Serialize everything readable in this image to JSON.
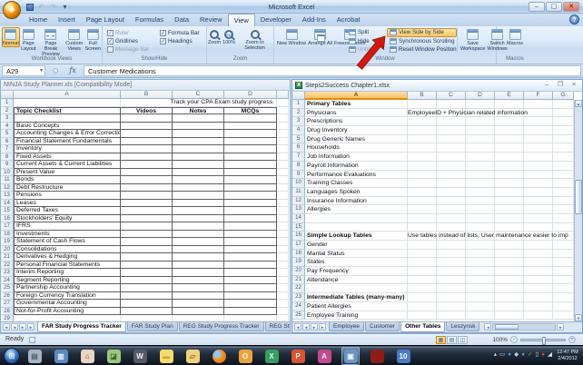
{
  "titlebar": {
    "title": "Microsoft Excel"
  },
  "ribbon": {
    "active_tab": "View",
    "tabs": [
      "Home",
      "Insert",
      "Page Layout",
      "Formulas",
      "Data",
      "Review",
      "View",
      "Developer",
      "Add-Ins",
      "Acrobat"
    ],
    "groups": {
      "workbook_views": {
        "label": "Workbook Views",
        "buttons": [
          {
            "label": "Normal",
            "icon": "normal-view-icon",
            "selected": true
          },
          {
            "label": "Page Layout",
            "icon": "page-layout-icon"
          },
          {
            "label": "Page Break Preview",
            "icon": "page-break-preview-icon"
          },
          {
            "label": "Custom Views",
            "icon": "custom-views-icon"
          },
          {
            "label": "Full Screen",
            "icon": "full-screen-icon"
          }
        ]
      },
      "show_hide": {
        "label": "Show/Hide",
        "col1": [
          {
            "label": "Ruler",
            "checked": true,
            "disabled": true
          },
          {
            "label": "Gridlines",
            "checked": true
          },
          {
            "label": "Message Bar",
            "checked": false,
            "disabled": true
          }
        ],
        "col2": [
          {
            "label": "Formula Bar",
            "checked": true
          },
          {
            "label": "Headings",
            "checked": true
          }
        ]
      },
      "zoom": {
        "label": "Zoom",
        "buttons": [
          {
            "label": "Zoom",
            "icon": "zoom-icon"
          },
          {
            "label": "100%",
            "icon": "zoom-100-icon"
          },
          {
            "label": "Zoom to Selection",
            "icon": "zoom-to-selection-icon"
          }
        ]
      },
      "window": {
        "label": "Window",
        "big_buttons": [
          {
            "label": "New Window",
            "icon": "new-window-icon"
          },
          {
            "label": "Arrange All",
            "icon": "arrange-all-icon"
          },
          {
            "label": "Freeze Panes",
            "icon": "freeze-panes-icon"
          }
        ],
        "small_buttons": [
          {
            "label": "Split",
            "icon": "split-icon"
          },
          {
            "label": "Hide",
            "icon": "hide-icon"
          },
          {
            "label": "Unhide",
            "icon": "unhide-icon",
            "disabled": true
          }
        ],
        "side_buttons": [
          {
            "label": "View Side by Side",
            "icon": "view-side-by-side-icon",
            "highlighted": true
          },
          {
            "label": "Synchronous Scrolling",
            "icon": "synchronous-scrolling-icon"
          },
          {
            "label": "Reset Window Position",
            "icon": "reset-window-position-icon"
          }
        ],
        "right_buttons": [
          {
            "label": "Save Workspace",
            "icon": "save-workspace-icon"
          },
          {
            "label": "Switch Windows",
            "icon": "switch-windows-icon"
          }
        ]
      },
      "macros": {
        "label": "Macros",
        "button": {
          "label": "Macros",
          "icon": "macros-icon"
        }
      }
    }
  },
  "formula_bar": {
    "name_box": "A29",
    "fx": "fx",
    "value": "Customer Medications"
  },
  "left_pane": {
    "caption": "NINJA Study Planner.xls  [Compatibility Mode]",
    "columns": [
      "A",
      "B",
      "C",
      "D"
    ],
    "rows": [
      {
        "overlay": "Track your CPA Exam study progress."
      },
      {
        "a": "Topic Checklist",
        "b": "Videos",
        "c": "Notes",
        "d": "MCQs",
        "bold": true
      },
      {},
      {
        "a": "Basic Concepts"
      },
      {
        "a": "Accounting Changes & Error Correction"
      },
      {
        "a": "Financial Statement Fundamentals"
      },
      {
        "a": "Inventory"
      },
      {
        "a": "Fixed Assets"
      },
      {
        "a": "Current Assets & Current Liabilities"
      },
      {
        "a": "Present Value"
      },
      {
        "a": "Bonds"
      },
      {
        "a": "Debt Restructure"
      },
      {
        "a": "Pensions"
      },
      {
        "a": "Leases"
      },
      {
        "a": "Deferred Taxes"
      },
      {
        "a": "Stockholders' Equity"
      },
      {
        "a": "IFRS"
      },
      {
        "a": "Investments"
      },
      {
        "a": "Statement of Cash Flows"
      },
      {
        "a": "Consolidations"
      },
      {
        "a": "Derivatives & Hedging"
      },
      {
        "a": "Personal Financial Statements"
      },
      {
        "a": "Interim Reporting"
      },
      {
        "a": "Segment Reporting"
      },
      {
        "a": "Partnership Accounting"
      },
      {
        "a": "Foreign Currency Translation"
      },
      {
        "a": "Governmental Accounting"
      },
      {
        "a": "Not-for-Profit Accounting"
      },
      {}
    ],
    "sheet_tabs": [
      {
        "label": "FAR Study Progress Tracker",
        "active": true
      },
      {
        "label": "FAR Study Plan"
      },
      {
        "label": "REG Study Progress Tracker"
      },
      {
        "label": "REG Study"
      }
    ]
  },
  "right_pane": {
    "caption": "Steps2Success Chapter1.xlsx",
    "columns": [
      "A",
      "B",
      "C",
      "D",
      "E",
      "F",
      "G"
    ],
    "selected_column": "A",
    "rows": [
      {
        "a": "Primary Tables",
        "bold": true
      },
      {
        "a": "Physicians",
        "note": "EmployeeID + Physician related information"
      },
      {
        "a": "Prescriptions"
      },
      {
        "a": "Drug Inventory"
      },
      {
        "a": "Drug Generic Names"
      },
      {
        "a": "Households"
      },
      {
        "a": "Job Information"
      },
      {
        "a": "Payroll Information"
      },
      {
        "a": "Performance Evaluations"
      },
      {
        "a": "Training Classes"
      },
      {
        "a": "Languages Spoken"
      },
      {
        "a": "Insurance Information"
      },
      {
        "a": "Allergies"
      },
      {},
      {},
      {
        "a": "Simple Lookup Tables",
        "bold": true,
        "note": "Use tables instead of lists; User maintenance easier to imp"
      },
      {
        "a": "Gender"
      },
      {
        "a": "Marital Status"
      },
      {
        "a": "States"
      },
      {
        "a": "Pay Frequency"
      },
      {
        "a": "Attendance"
      },
      {},
      {
        "a": "Intermediate Tables (many-many)",
        "bold": true
      },
      {
        "a": "Patient Allergies"
      },
      {
        "a": "Employee Training"
      }
    ],
    "sheet_tabs": [
      {
        "label": "Employee"
      },
      {
        "label": "Customer"
      },
      {
        "label": "Other Tables",
        "active": true
      },
      {
        "label": "Leszynsk"
      }
    ]
  },
  "status_bar": {
    "mode": "Ready",
    "zoom_level": "100%"
  },
  "taskbar": {
    "icons": [
      {
        "name": "taskbar-notes-app-icon",
        "glyph": "▤",
        "bg": "#a8b4c2",
        "fg": "#53627a"
      },
      {
        "name": "taskbar-journal-icon",
        "glyph": "▥",
        "bg": "#5b87c5",
        "fg": "#eaf2fb"
      },
      {
        "name": "taskbar-home-finance-icon",
        "glyph": "⌂",
        "bg": "#e8d6c2",
        "fg": "#8c3a22"
      },
      {
        "name": "taskbar-photo-gallery-icon",
        "glyph": "◪",
        "bg": "#9cc87e",
        "fg": "#3f6b2a"
      },
      {
        "name": "taskbar-word-app-icon",
        "glyph": "W",
        "bg": "#585868",
        "fg": "#f2f2f6"
      },
      {
        "name": "taskbar-sticky-notes-icon",
        "glyph": "▬",
        "bg": "#f2dc6e",
        "fg": "#c9a93a"
      },
      {
        "name": "taskbar-explorer-icon",
        "glyph": "▱",
        "bg": "#f0d27c",
        "fg": "#8a6b28"
      },
      {
        "name": "taskbar-firefox-icon",
        "glyph": "",
        "bg": "radial-gradient(circle at 35% 35%, #8cc8f0 0%, #8cc8f0 28%, #f59a2c 34%, #e06a14 90%)",
        "fg": "#ffffff",
        "round": true
      },
      {
        "name": "taskbar-outlook-icon",
        "glyph": "O",
        "bg": "#e8a33d",
        "fg": "#fff8ea"
      },
      {
        "name": "taskbar-excel-icon",
        "glyph": "X",
        "bg": "#35a05c",
        "fg": "#eafaf0"
      },
      {
        "name": "taskbar-powerpoint-icon",
        "glyph": "P",
        "bg": "#d65532",
        "fg": "#fdf0ea"
      },
      {
        "name": "taskbar-access-icon",
        "glyph": "A",
        "bg": "#c24a8c",
        "fg": "#fdeaf4"
      },
      {
        "name": "taskbar-active-window-icon",
        "glyph": "▣",
        "bg": "#6d93c0",
        "fg": "#eaf2fc",
        "active": true
      },
      {
        "name": "taskbar-maroon-app-icon",
        "glyph": "",
        "bg": "#8c1d18",
        "fg": "#ffffff"
      },
      {
        "name": "taskbar-quicken-10-icon",
        "glyph": "10",
        "bg": "#4a7cc8",
        "fg": "#ffffff"
      }
    ],
    "tray": [
      {
        "name": "tray-customize-icon",
        "glyph": "▴",
        "color": "#cfd9e4"
      },
      {
        "name": "tray-power-icon",
        "glyph": "▭",
        "color": "#cfd9e4"
      },
      {
        "name": "tray-help-center-icon",
        "glyph": "●",
        "color": "#5f97d8"
      },
      {
        "name": "tray-update-icon",
        "glyph": "◆",
        "color": "#bcc9d8"
      },
      {
        "name": "tray-network-icon",
        "glyph": "●",
        "color": "#4f9fd8"
      },
      {
        "name": "tray-antivirus-icon",
        "glyph": "✓",
        "color": "#57b447"
      },
      {
        "name": "tray-clipboard-icon",
        "glyph": "▯",
        "color": "#cfd9e4"
      },
      {
        "name": "tray-alert-icon",
        "glyph": "●",
        "color": "#d23f34"
      },
      {
        "name": "tray-signal-icon",
        "glyph": "◢",
        "color": "#d8e2ec"
      }
    ],
    "clock": {
      "time": "12:47 PM",
      "date": "2/4/2012"
    }
  },
  "colors": {
    "selection_highlight": "#fbc65e",
    "annotation_arrow": "#d11a0f",
    "selected_column_header": "#f9c169",
    "taskbar_active": "#6d93c0"
  }
}
